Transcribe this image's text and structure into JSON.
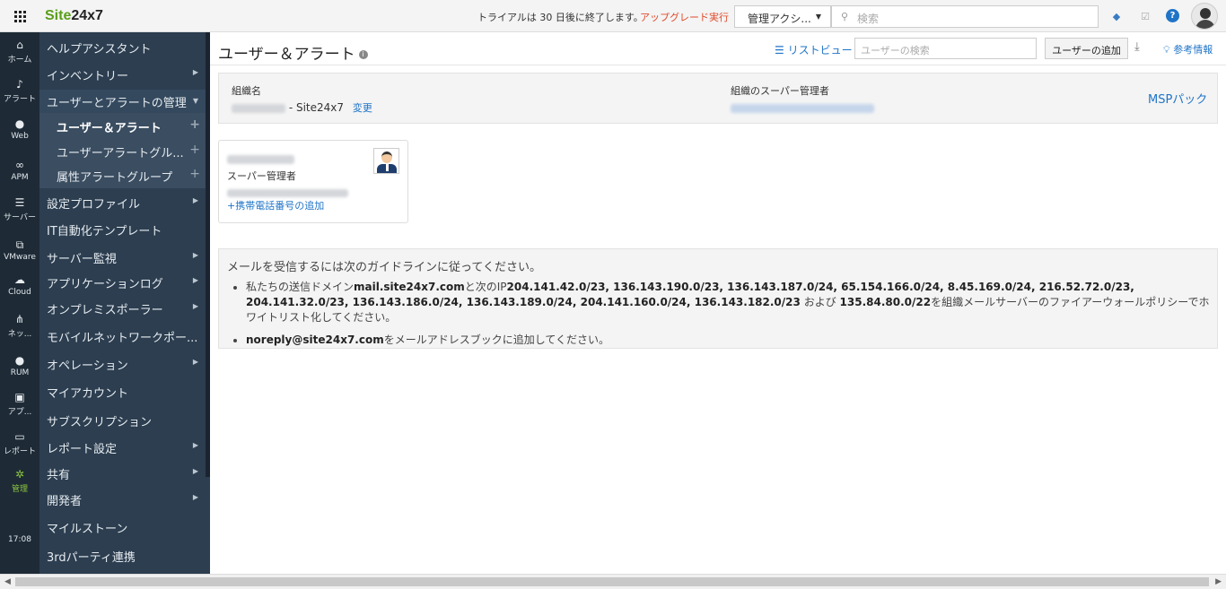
{
  "topbar": {
    "logo_a": "Site",
    "logo_b": "24x7",
    "trial": "トライアルは 30 日後に終了します。",
    "upgrade": "アップグレード実行",
    "admin_dropdown": "管理アクシ...",
    "search_placeholder": "検索"
  },
  "rail": [
    {
      "icon": "home-icon",
      "label": "ホーム"
    },
    {
      "icon": "bell-icon",
      "label": "アラート"
    },
    {
      "icon": "globe-icon",
      "label": "Web"
    },
    {
      "icon": "binoculars-icon",
      "label": "APM"
    },
    {
      "icon": "server-icon",
      "label": "サーバー"
    },
    {
      "icon": "vmware-icon",
      "label": "VMware"
    },
    {
      "icon": "cloud-icon",
      "label": "Cloud"
    },
    {
      "icon": "network-icon",
      "label": "ネッ..."
    },
    {
      "icon": "globe-icon",
      "label": "RUM"
    },
    {
      "icon": "app-icon",
      "label": "アプ..."
    },
    {
      "icon": "report-icon",
      "label": "レポート"
    },
    {
      "icon": "gear-icon",
      "label": "管理"
    }
  ],
  "rail_time": "17:08",
  "menu": [
    {
      "label": "ヘルプアシスタント"
    },
    {
      "label": "インベントリー"
    },
    {
      "label": "ユーザーとアラートの管理"
    },
    {
      "label": "ユーザー＆アラート"
    },
    {
      "label": "ユーザーアラートグル..."
    },
    {
      "label": "属性アラートグループ"
    },
    {
      "label": "設定プロファイル"
    },
    {
      "label": "IT自動化テンプレート"
    },
    {
      "label": "サーバー監視"
    },
    {
      "label": "アプリケーションログ"
    },
    {
      "label": "オンプレミスポーラー"
    },
    {
      "label": "モバイルネットワークポー..."
    },
    {
      "label": "オペレーション"
    },
    {
      "label": "マイアカウント"
    },
    {
      "label": "サブスクリプション"
    },
    {
      "label": "レポート設定"
    },
    {
      "label": "共有"
    },
    {
      "label": "開発者"
    },
    {
      "label": "マイルストーン"
    },
    {
      "label": "3rdパーティ連携"
    }
  ],
  "main": {
    "title": "ユーザー＆アラート",
    "list_view": "リストビュー",
    "user_search_placeholder": "ユーザーの検索",
    "add_user": "ユーザーの追加",
    "reference": "参考情報",
    "org_label": "組織名",
    "org_value_suffix": "Site24x7",
    "change": "変更",
    "super_admin_label": "組織のスーパー管理者",
    "msp_pack": "MSPパック",
    "user_role": "スーパー管理者",
    "add_phone": "+携帯電話番号の追加",
    "guide_head": "メールを受信するには次のガイドラインに従ってください。",
    "guide_1a": "私たちの送信ドメイン",
    "guide_1b": "mail.site24x7.com",
    "guide_1c": "と次のIP",
    "guide_1d": "204.141.42.0/23, 136.143.190.0/23, 136.143.187.0/24, 65.154.166.0/24, 8.45.169.0/24, 216.52.72.0/23, 204.141.32.0/23, 136.143.186.0/24, 136.143.189.0/24, 204.141.160.0/24, 136.143.182.0/23",
    "guide_1e": " および ",
    "guide_1f": "135.84.80.0/22",
    "guide_1g": "を組織メールサーバーのファイアーウォールポリシーでホワイトリスト化してください。",
    "guide_2a": "noreply@site24x7.com",
    "guide_2b": "をメールアドレスブックに追加してください。"
  }
}
